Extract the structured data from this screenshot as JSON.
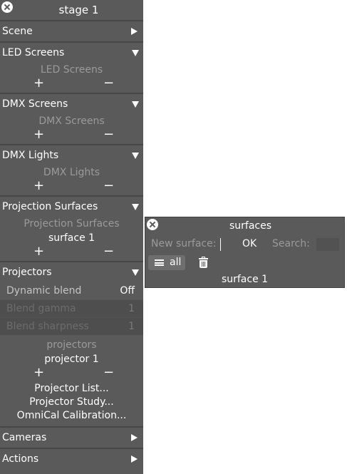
{
  "window": {
    "title": "stage 1"
  },
  "sections": {
    "scene": {
      "label": "Scene"
    },
    "led": {
      "label": "LED Screens",
      "placeholder": "LED Screens"
    },
    "dmx_screens": {
      "label": "DMX Screens",
      "placeholder": "DMX Screens"
    },
    "dmx_lights": {
      "label": "DMX Lights",
      "placeholder": "DMX Lights"
    },
    "projection_surfaces": {
      "label": "Projection Surfaces",
      "placeholder": "Projection Surfaces",
      "items": [
        "surface 1"
      ]
    },
    "projectors": {
      "label": "Projectors",
      "params": [
        {
          "label": "Dynamic blend",
          "value": "Off"
        },
        {
          "label": "Blend gamma",
          "value": "1"
        },
        {
          "label": "Blend sharpness",
          "value": "1"
        }
      ],
      "placeholder": "projectors",
      "items": [
        "projector 1"
      ],
      "menu": [
        "Projector List...",
        "Projector Study...",
        "OmniCal Calibration..."
      ]
    },
    "cameras": {
      "label": "Cameras"
    },
    "actions": {
      "label": "Actions"
    }
  },
  "controls": {
    "plus": "+",
    "minus": "−"
  },
  "surfaces_dialog": {
    "title": "surfaces",
    "new_surface_label": "New surface:",
    "ok_label": "OK",
    "search_label": "Search:",
    "all_label": "all",
    "items": [
      "surface 1"
    ]
  },
  "icons": {
    "close": "close-icon",
    "expanded": "triangle-down-icon",
    "collapsed": "triangle-right-icon",
    "list": "list-icon",
    "trash": "trash-icon"
  },
  "colors": {
    "panel_bg": "#5a5a5a",
    "text": "#ffffff",
    "muted_text": "#9a9a9a",
    "divider": "#474747"
  }
}
